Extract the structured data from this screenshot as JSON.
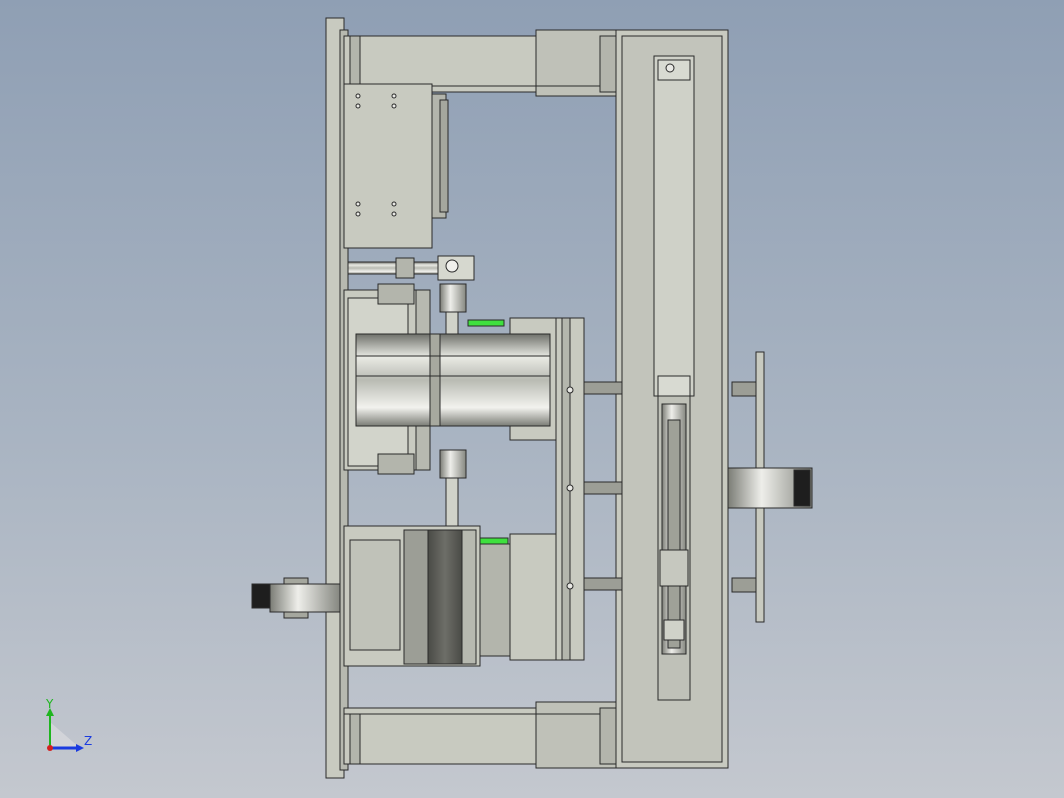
{
  "triad": {
    "y_label": "Y",
    "z_label": "Z",
    "y_color": "#1fb51f",
    "z_color": "#1a3be0",
    "x_color": "#d42020"
  },
  "colors": {
    "background_top": "#8f9fb4",
    "background_bottom": "#c4c8cf",
    "part_fill": "#c8cac0",
    "part_dark": "#8e8f87",
    "edge": "#2a2a2a",
    "highlight": "#3ee03e"
  }
}
